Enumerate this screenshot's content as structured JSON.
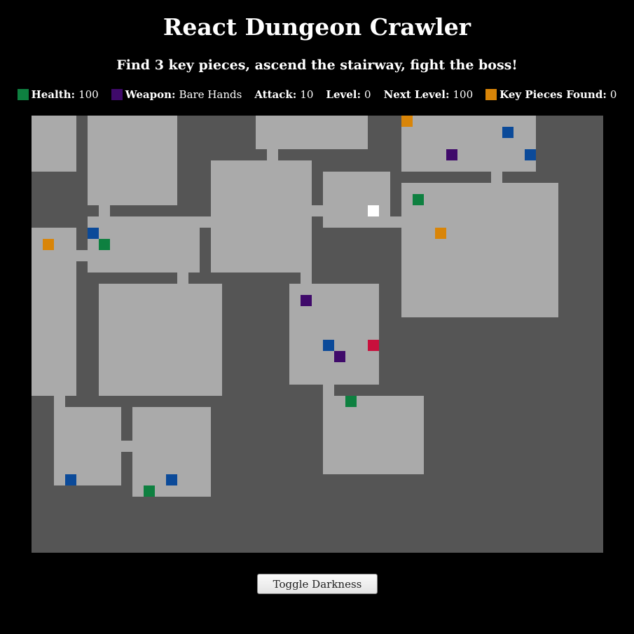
{
  "title": "React Dungeon Crawler",
  "subtitle": "Find 3 key pieces, ascend the stairway, fight the boss!",
  "stats": {
    "health_label": "Health:",
    "health_value": "100",
    "weapon_label": "Weapon:",
    "weapon_value": "Bare Hands",
    "attack_label": "Attack:",
    "attack_value": "10",
    "level_label": "Level:",
    "level_value": "0",
    "next_level_label": "Next Level:",
    "next_level_value": "100",
    "key_label": "Key Pieces Found:",
    "key_value": "0"
  },
  "colors": {
    "wall": "#555555",
    "floor": "#aaaaaa",
    "player": "#ffffff",
    "health": "#0e8040",
    "weapon": "#3f0a6a",
    "enemy": "#0b4a99",
    "key": "#d98508",
    "boss": "#c8103c"
  },
  "legend": {
    "health": "Health potion",
    "weapon": "Weapon",
    "enemy": "Enemy",
    "key": "Key piece",
    "player": "Player",
    "boss": "Boss"
  },
  "toggle_button": "Toggle Darkness"
}
